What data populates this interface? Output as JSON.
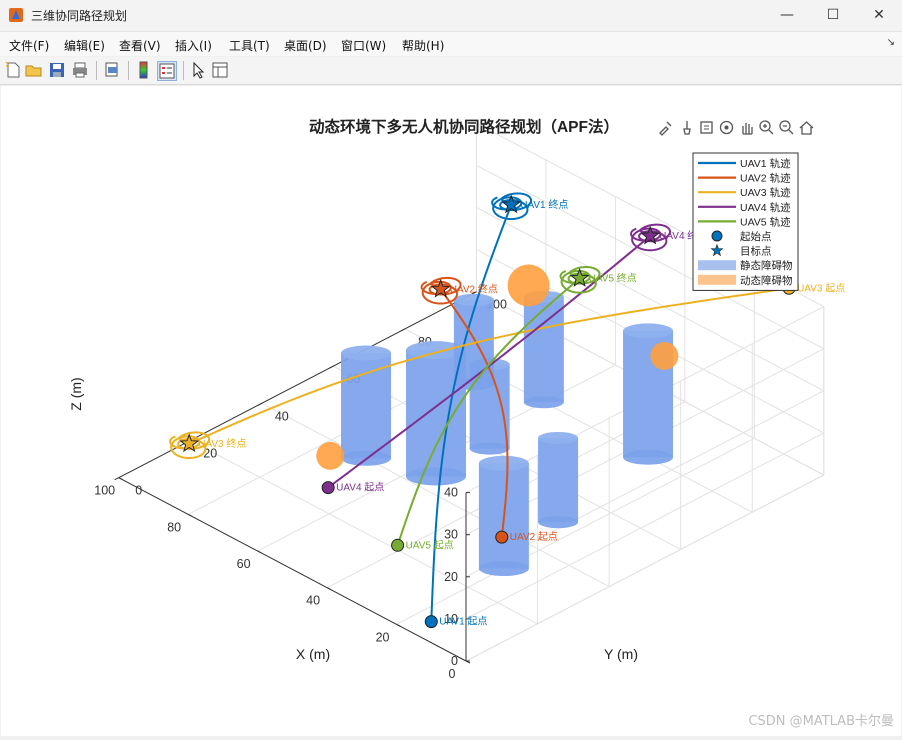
{
  "window": {
    "title": "三维协同路径规划",
    "minimize": "—",
    "maximize": "☐",
    "close": "✕"
  },
  "menu": [
    "文件(F)",
    "编辑(E)",
    "查看(V)",
    "插入(I)",
    "工具(T)",
    "桌面(D)",
    "窗口(W)",
    "帮助(H)"
  ],
  "toolbar": [
    "new-figure-icon",
    "open-file-icon",
    "save-icon",
    "print-icon",
    "print-preview-icon",
    "colorbar-icon",
    "legend-icon",
    "pointer-icon",
    "property-inspector-icon"
  ],
  "axes_toolbar": [
    "brush-icon",
    "data-tips-icon",
    "export-icon",
    "rotate-icon",
    "pan-icon",
    "zoom-in-icon",
    "zoom-out-icon",
    "home-icon"
  ],
  "chart_data": {
    "type": "line3d",
    "title": "动态环境下多无人机协同路径规划（APF法）",
    "xlabel": "X (m)",
    "ylabel": "Y (m)",
    "zlabel": "Z (m)",
    "xlim": [
      0,
      100
    ],
    "ylim": [
      0,
      100
    ],
    "zlim": [
      0,
      40
    ],
    "x_ticks": [
      "0",
      "20",
      "40",
      "60",
      "80",
      "100"
    ],
    "y_ticks": [
      "0",
      "20",
      "40",
      "60",
      "80",
      "100"
    ],
    "z_ticks": [
      "0",
      "10",
      "20",
      "30",
      "40"
    ],
    "grid": true,
    "legend_position": "top-right",
    "legend": [
      {
        "label": "UAV1 轨迹",
        "kind": "line",
        "color": "#0072bd"
      },
      {
        "label": "UAV2 轨迹",
        "kind": "line",
        "color": "#d95319"
      },
      {
        "label": "UAV3 轨迹",
        "kind": "line",
        "color": "#edb120"
      },
      {
        "label": "UAV4 轨迹",
        "kind": "line",
        "color": "#7e2f8e"
      },
      {
        "label": "UAV5 轨迹",
        "kind": "line",
        "color": "#77ac30"
      },
      {
        "label": "起始点",
        "kind": "circle",
        "color": "#0072bd"
      },
      {
        "label": "目标点",
        "kind": "star",
        "color": "#0072bd"
      },
      {
        "label": "静态障碍物",
        "kind": "patch",
        "color": "#a8c0ee"
      },
      {
        "label": "动态障碍物",
        "kind": "patch",
        "color": "#ffc48c"
      }
    ],
    "uavs": [
      {
        "name": "UAV1",
        "color": "#0072bd",
        "start": [
          10,
          0,
          5
        ],
        "goal": [
          90,
          100,
          25
        ],
        "start_label": "UAV1 起点",
        "goal_label": "UAV1 终点"
      },
      {
        "name": "UAV2",
        "color": "#d95319",
        "start": [
          0,
          10,
          25
        ],
        "goal": [
          100,
          90,
          5
        ],
        "start_label": "UAV2 起点",
        "goal_label": "UAV2 终点"
      },
      {
        "name": "UAV3",
        "color": "#edb120",
        "start": [
          10,
          100,
          40
        ],
        "goal": [
          90,
          10,
          8
        ],
        "start_label": "UAV3 起点",
        "goal_label": "UAV3 终点"
      },
      {
        "name": "UAV4",
        "color": "#7e2f8e",
        "start": [
          50,
          10,
          15
        ],
        "goal": [
          50,
          100,
          35
        ],
        "start_label": "UAV4 起点",
        "goal_label": "UAV4 终点"
      },
      {
        "name": "UAV5",
        "color": "#77ac30",
        "start": [
          30,
          10,
          10
        ],
        "goal": [
          60,
          90,
          25
        ],
        "start_label": "UAV5 起点",
        "goal_label": "UAV5 终点"
      }
    ],
    "static_obstacles": [
      {
        "center": [
          20,
          30
        ],
        "radius": 5,
        "height": 25
      },
      {
        "center": [
          25,
          50
        ],
        "radius": 4,
        "height": 20
      },
      {
        "center": [
          55,
          45
        ],
        "radius": 6,
        "height": 30
      },
      {
        "center": [
          30,
          80
        ],
        "radius": 5,
        "height": 30
      },
      {
        "center": [
          70,
          40
        ],
        "radius": 5,
        "height": 25
      },
      {
        "center": [
          75,
          75
        ],
        "radius": 4,
        "height": 20
      },
      {
        "center": [
          55,
          60
        ],
        "radius": 4,
        "height": 20
      },
      {
        "center": [
          60,
          80
        ],
        "radius": 4,
        "height": 25
      }
    ],
    "dynamic_obstacles": [
      {
        "center": [
          70,
          30,
          5
        ],
        "radius": 4
      },
      {
        "center": [
          15,
          70,
          35
        ],
        "radius": 4
      },
      {
        "center": [
          85,
          100,
          8
        ],
        "radius": 6
      }
    ]
  },
  "watermark": "CSDN @MATLAB卡尔曼"
}
